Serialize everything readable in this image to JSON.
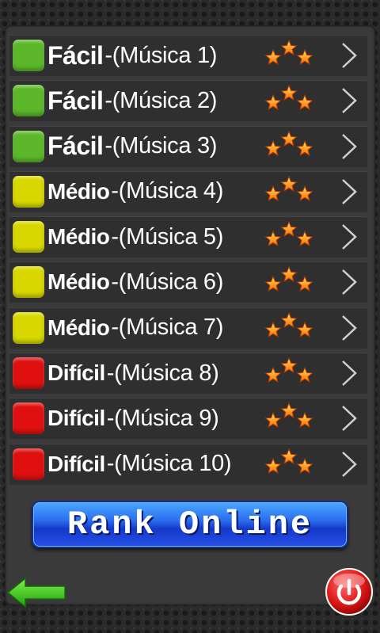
{
  "levels": [
    {
      "difficulty": "Fácil",
      "song": "-(Música 1)",
      "color": "#5cb82a",
      "tier": "easy"
    },
    {
      "difficulty": "Fácil",
      "song": "-(Música 2)",
      "color": "#5cb82a",
      "tier": "easy"
    },
    {
      "difficulty": "Fácil",
      "song": "-(Música 3)",
      "color": "#5cb82a",
      "tier": "easy"
    },
    {
      "difficulty": "Médio",
      "song": "-(Música 4)",
      "color": "#d8d800",
      "tier": "med"
    },
    {
      "difficulty": "Médio",
      "song": "-(Música 5)",
      "color": "#d8d800",
      "tier": "med"
    },
    {
      "difficulty": "Médio",
      "song": "-(Música 6)",
      "color": "#d8d800",
      "tier": "med"
    },
    {
      "difficulty": "Médio",
      "song": "-(Música 7)",
      "color": "#d8d800",
      "tier": "med"
    },
    {
      "difficulty": "Difícil ",
      "song": "-(Música 8)",
      "color": "#e01010",
      "tier": "dif"
    },
    {
      "difficulty": "Difícil ",
      "song": "-(Música 9)",
      "color": "#e01010",
      "tier": "dif"
    },
    {
      "difficulty": "Difícil ",
      "song": "-(Música 10)",
      "color": "#e01010",
      "tier": "dif"
    }
  ],
  "rank_button": {
    "label": "Rank Online",
    "color": "#2c6ff0"
  },
  "icons": {
    "back": "back-arrow-icon",
    "power": "power-icon",
    "stars": "three-stars-icon",
    "chevron": "chevron-right-icon"
  },
  "colors": {
    "back_arrow": "#3fbf1f",
    "power": "#e01818"
  }
}
